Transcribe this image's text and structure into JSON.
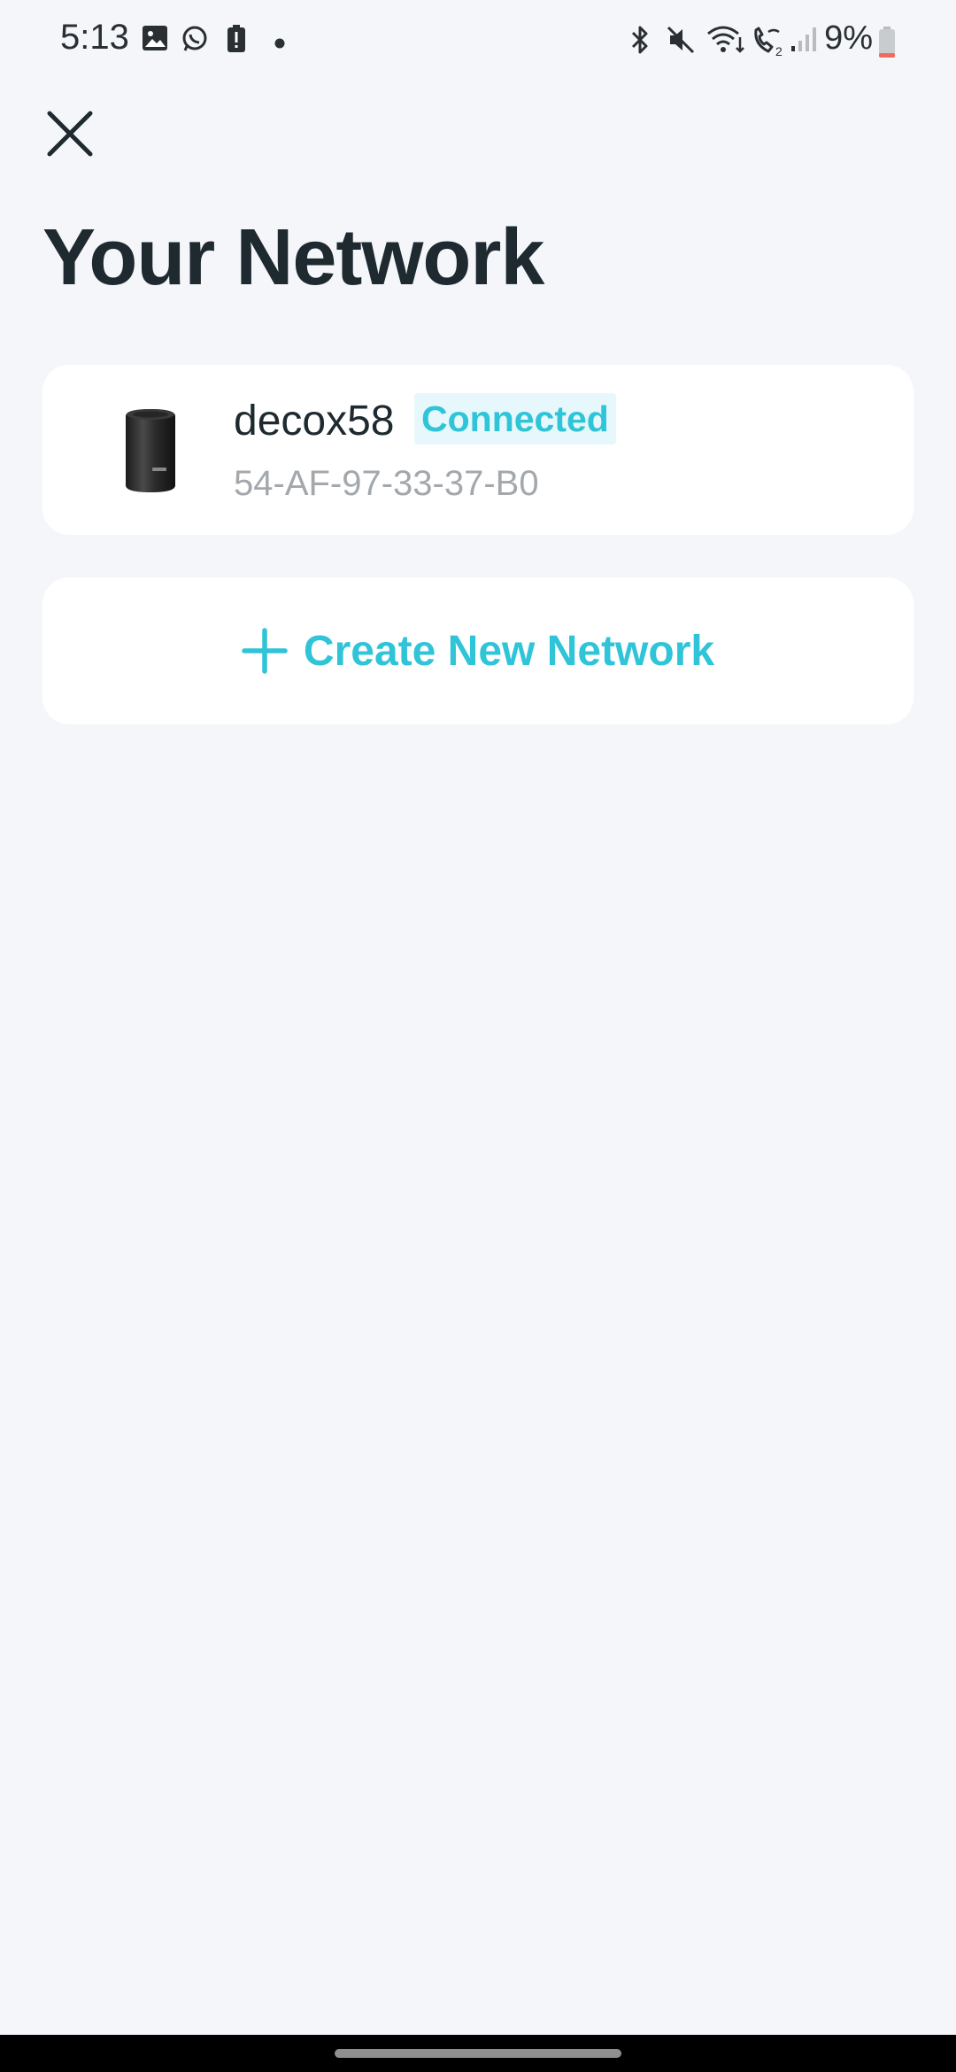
{
  "status_bar": {
    "time": "5:13",
    "battery_percent": "9%",
    "battery_level": 0.09,
    "icons_left": [
      "gallery-icon",
      "whatsapp-icon",
      "battery-alert-icon",
      "dot-icon"
    ],
    "icons_right": [
      "bluetooth-icon",
      "mute-icon",
      "wifi-icon",
      "wifi-calling-icon",
      "signal-icon",
      "battery-icon"
    ]
  },
  "header": {
    "close_icon": "close-icon",
    "title": "Your Network"
  },
  "networks": [
    {
      "name": "decox58",
      "status": "Connected",
      "mac": "54-AF-97-33-37-B0",
      "device_icon": "deco-router-icon"
    }
  ],
  "actions": {
    "create_label": "Create New Network",
    "create_icon": "plus-icon"
  },
  "colors": {
    "accent": "#2fc4d8",
    "badge_bg": "#e6f8fb",
    "background": "#f4f6fa",
    "card": "#ffffff",
    "text_primary": "#1e2a30",
    "text_secondary": "#a3a8ad"
  }
}
